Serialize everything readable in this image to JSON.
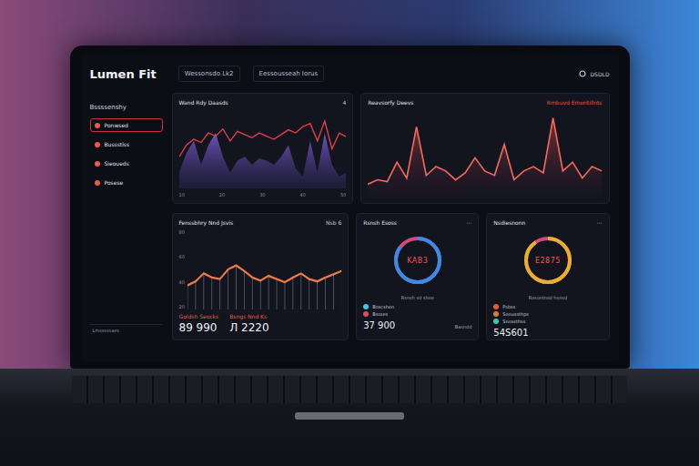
{
  "app": {
    "logo": "Lumen Fit",
    "tabs": [
      {
        "label": "Wessonsdo Lk2",
        "selected": false
      },
      {
        "label": "Eessousseah Iorus",
        "selected": false
      }
    ],
    "status": "DSDLD"
  },
  "sidebar": {
    "heading": "Bssssenshy",
    "items": [
      {
        "label": "Ponwsed",
        "selected": true
      },
      {
        "label": "Bussstlss",
        "selected": false
      },
      {
        "label": "Sieoueds",
        "selected": false
      },
      {
        "label": "Posese",
        "selected": false
      }
    ],
    "footer": "Lmsssssaes"
  },
  "heart_chart": {
    "title": "Wand Rdy Daasds",
    "badge": "4",
    "line": [
      40,
      55,
      62,
      58,
      70,
      66,
      75,
      60,
      72,
      68,
      64,
      70,
      66,
      62,
      68,
      74,
      70,
      78,
      82,
      60,
      85,
      50,
      70,
      65
    ],
    "area": [
      20,
      45,
      60,
      30,
      55,
      70,
      40,
      20,
      35,
      40,
      30,
      38,
      35,
      30,
      40,
      55,
      25,
      15,
      60,
      20,
      70,
      30,
      15,
      20
    ],
    "ticks": [
      "10",
      "20",
      "30",
      "40",
      "50"
    ]
  },
  "recovery_chart": {
    "title": "Reavsorfy Deevs",
    "tag": "Rmbuvd Emontillnts",
    "values": [
      15,
      20,
      18,
      40,
      22,
      80,
      25,
      35,
      30,
      20,
      28,
      45,
      30,
      25,
      60,
      20,
      30,
      35,
      28,
      90,
      30,
      40,
      22,
      35,
      30
    ]
  },
  "trend_chart": {
    "title": "Fenssbhry Nnd Jsvis",
    "badge": "Nsb 6",
    "ticks": [
      "80",
      "60",
      "40",
      "20"
    ],
    "values": [
      30,
      35,
      45,
      40,
      38,
      50,
      55,
      48,
      40,
      36,
      42,
      38,
      34,
      40,
      45,
      38,
      35,
      40,
      44,
      48
    ],
    "stats": [
      {
        "label": "Goldsh Seocks",
        "value": "89 990"
      },
      {
        "label": "Bsngs Nnd Ks",
        "value": "Л 2220"
      }
    ]
  },
  "gauges": [
    {
      "title": "Rsnsh Esoss",
      "reading": "KAB3",
      "caption": "Rsnsh sd shoe",
      "level": 0.85,
      "color": "#3a8ae8",
      "legend": [
        {
          "label": "Boscshon",
          "color": "#3ac8e8"
        },
        {
          "label": "Bssses",
          "color": "#e04a5a"
        }
      ],
      "value": "37 900",
      "note": "Basndd"
    },
    {
      "title": "Nsdiesnonn",
      "reading": "E2875",
      "caption": "Rosontnsd hsnsd",
      "level": 0.9,
      "color": "#e8b030",
      "legend": [
        {
          "label": "Psbss",
          "color": "#e85a3a"
        },
        {
          "label": "Sooussthps",
          "color": "#e07a3a"
        },
        {
          "label": "Snossthss",
          "color": "#3ac8b0"
        }
      ],
      "value": "54S601",
      "note": ""
    }
  ]
}
